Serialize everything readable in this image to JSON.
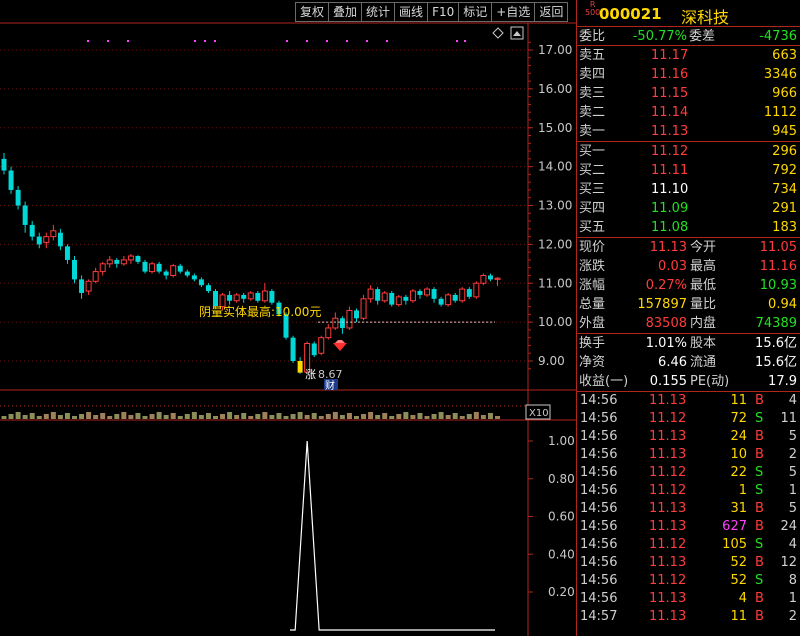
{
  "toolbar": [
    {
      "label": "复权"
    },
    {
      "label": "叠加"
    },
    {
      "label": "统计"
    },
    {
      "label": "画线"
    },
    {
      "label": "F10"
    },
    {
      "label": "标记"
    },
    {
      "label": "+自选"
    },
    {
      "label": "返回"
    }
  ],
  "chart_data": [
    {
      "type": "candlestick",
      "price_ticks": [
        "17.00",
        "16.00",
        "15.00",
        "14.00",
        "13.00",
        "12.00",
        "11.00",
        "10.00",
        "9.00"
      ],
      "ylim": [
        8.5,
        17.5
      ],
      "annotations": {
        "max_label": "阴量实体最高:10.00元",
        "max_value": 10.0,
        "min_label": "8.67",
        "min_value": 8.67,
        "cai_badge": "财",
        "up_label": "涨",
        "zoom_label": "X10"
      },
      "candles": [
        [
          14.2,
          13.9,
          14.35,
          13.8
        ],
        [
          13.9,
          13.4,
          14.0,
          13.3
        ],
        [
          13.4,
          13.0,
          13.5,
          12.9
        ],
        [
          13.0,
          12.5,
          13.1,
          12.3
        ],
        [
          12.5,
          12.2,
          12.6,
          12.1
        ],
        [
          12.2,
          12.0,
          12.3,
          11.9
        ],
        [
          12.05,
          12.2,
          12.3,
          11.9
        ],
        [
          12.2,
          12.35,
          12.5,
          12.1
        ],
        [
          12.3,
          11.95,
          12.4,
          11.85
        ],
        [
          11.95,
          11.6,
          12.0,
          11.5
        ],
        [
          11.6,
          11.1,
          11.7,
          11.0
        ],
        [
          11.1,
          10.75,
          11.2,
          10.6
        ],
        [
          10.8,
          11.05,
          11.1,
          10.7
        ],
        [
          11.05,
          11.3,
          11.4,
          11.0
        ],
        [
          11.3,
          11.5,
          11.55,
          11.2
        ],
        [
          11.5,
          11.6,
          11.7,
          11.4
        ],
        [
          11.6,
          11.5,
          11.65,
          11.4
        ],
        [
          11.5,
          11.6,
          11.7,
          11.45
        ],
        [
          11.6,
          11.7,
          11.75,
          11.5
        ],
        [
          11.7,
          11.55,
          11.72,
          11.5
        ],
        [
          11.55,
          11.3,
          11.6,
          11.25
        ],
        [
          11.3,
          11.5,
          11.55,
          11.25
        ],
        [
          11.5,
          11.3,
          11.55,
          11.25
        ],
        [
          11.3,
          11.2,
          11.35,
          11.1
        ],
        [
          11.2,
          11.45,
          11.5,
          11.15
        ],
        [
          11.45,
          11.3,
          11.5,
          11.25
        ],
        [
          11.3,
          11.2,
          11.35,
          11.15
        ],
        [
          11.2,
          11.1,
          11.25,
          11.05
        ],
        [
          11.1,
          10.95,
          11.15,
          10.9
        ],
        [
          10.95,
          10.8,
          11.0,
          10.75
        ],
        [
          10.8,
          10.4,
          10.85,
          10.35
        ],
        [
          10.4,
          10.7,
          10.75,
          10.3
        ],
        [
          10.7,
          10.55,
          10.8,
          10.45
        ],
        [
          10.55,
          10.7,
          10.75,
          10.5
        ],
        [
          10.7,
          10.6,
          10.75,
          10.5
        ],
        [
          10.6,
          10.75,
          10.8,
          10.55
        ],
        [
          10.75,
          10.55,
          10.8,
          10.5
        ],
        [
          10.55,
          10.8,
          11.0,
          10.5
        ],
        [
          10.8,
          10.5,
          10.85,
          10.45
        ],
        [
          10.5,
          10.2,
          10.55,
          10.15
        ],
        [
          10.2,
          9.6,
          10.25,
          9.55
        ],
        [
          9.6,
          9.0,
          9.65,
          8.95
        ],
        [
          9.0,
          8.7,
          9.1,
          8.67
        ],
        [
          8.72,
          9.45,
          9.5,
          8.68
        ],
        [
          9.45,
          9.15,
          9.5,
          9.1
        ],
        [
          9.2,
          9.6,
          9.65,
          9.15
        ],
        [
          9.6,
          9.85,
          9.95,
          9.55
        ],
        [
          9.85,
          10.1,
          10.25,
          9.8
        ],
        [
          10.1,
          9.85,
          10.15,
          9.7
        ],
        [
          9.85,
          10.3,
          10.4,
          9.8
        ],
        [
          10.3,
          10.1,
          10.35,
          10.0
        ],
        [
          10.1,
          10.6,
          10.7,
          10.05
        ],
        [
          10.6,
          10.85,
          10.95,
          10.5
        ],
        [
          10.85,
          10.55,
          10.9,
          10.45
        ],
        [
          10.55,
          10.75,
          10.8,
          10.5
        ],
        [
          10.75,
          10.45,
          10.8,
          10.4
        ],
        [
          10.45,
          10.65,
          10.7,
          10.4
        ],
        [
          10.65,
          10.55,
          10.7,
          10.45
        ],
        [
          10.55,
          10.8,
          10.85,
          10.5
        ],
        [
          10.8,
          10.7,
          10.85,
          10.6
        ],
        [
          10.7,
          10.85,
          10.9,
          10.65
        ],
        [
          10.85,
          10.6,
          10.9,
          10.5
        ],
        [
          10.6,
          10.45,
          10.65,
          10.4
        ],
        [
          10.45,
          10.7,
          10.75,
          10.4
        ],
        [
          10.7,
          10.55,
          10.75,
          10.5
        ],
        [
          10.55,
          10.85,
          10.9,
          10.5
        ],
        [
          10.85,
          10.65,
          10.9,
          10.6
        ],
        [
          10.65,
          11.0,
          11.05,
          10.6
        ],
        [
          11.0,
          11.2,
          11.25,
          10.95
        ],
        [
          11.2,
          11.1,
          11.25,
          11.05
        ],
        [
          11.1,
          11.13,
          11.16,
          10.93
        ]
      ]
    },
    {
      "type": "line",
      "yticks": [
        "1.00",
        "0.80",
        "0.60",
        "0.40",
        "0.20"
      ],
      "ylim": [
        0,
        1.1
      ],
      "peak_index": 43,
      "peak_value": 1.0
    }
  ],
  "panel": {
    "rtag_top": "R",
    "rtag_bottom": "500",
    "code": "000021",
    "name": "深科技",
    "ratio": {
      "l1": "委比",
      "v1": "-50.77%",
      "l2": "委差",
      "v2": "-4736"
    },
    "asks": [
      {
        "label": "卖五",
        "price": "11.17",
        "vol": "663"
      },
      {
        "label": "卖四",
        "price": "11.16",
        "vol": "3346"
      },
      {
        "label": "卖三",
        "price": "11.15",
        "vol": "966"
      },
      {
        "label": "卖二",
        "price": "11.14",
        "vol": "1112"
      },
      {
        "label": "卖一",
        "price": "11.13",
        "vol": "945"
      }
    ],
    "bids": [
      {
        "label": "买一",
        "price": "11.12",
        "vol": "296"
      },
      {
        "label": "买二",
        "price": "11.11",
        "vol": "792"
      },
      {
        "label": "买三",
        "price": "11.10",
        "vol": "734"
      },
      {
        "label": "买四",
        "price": "11.09",
        "vol": "291"
      },
      {
        "label": "买五",
        "price": "11.08",
        "vol": "183"
      }
    ],
    "quote1": [
      {
        "l1": "现价",
        "v1": "11.13",
        "l2": "今开",
        "v2": "11.05"
      },
      {
        "l1": "涨跌",
        "v1": "0.03",
        "l2": "最高",
        "v2": "11.16"
      },
      {
        "l1": "涨幅",
        "v1": "0.27%",
        "l2": "最低",
        "v2": "10.93"
      },
      {
        "l1": "总量",
        "v1": "157897",
        "l2": "量比",
        "v2": "0.94"
      },
      {
        "l1": "外盘",
        "v1": "83508",
        "l2": "内盘",
        "v2": "74389"
      }
    ],
    "quote2": [
      {
        "l1": "换手",
        "v1": "1.01%",
        "l2": "股本",
        "v2": "15.6亿"
      },
      {
        "l1": "净资",
        "v1": "6.46",
        "l2": "流通",
        "v2": "15.6亿"
      },
      {
        "l1": "收益(一)",
        "v1": "0.155",
        "l2": "PE(动)",
        "v2": "17.9"
      }
    ],
    "trades": [
      {
        "time": "14:56",
        "price": "11.13",
        "vol": "11",
        "side": "B",
        "count": "4"
      },
      {
        "time": "14:56",
        "price": "11.12",
        "vol": "72",
        "side": "S",
        "count": "11"
      },
      {
        "time": "14:56",
        "price": "11.13",
        "vol": "24",
        "side": "B",
        "count": "5"
      },
      {
        "time": "14:56",
        "price": "11.13",
        "vol": "10",
        "side": "B",
        "count": "2"
      },
      {
        "time": "14:56",
        "price": "11.12",
        "vol": "22",
        "side": "S",
        "count": "5"
      },
      {
        "time": "14:56",
        "price": "11.12",
        "vol": "1",
        "side": "S",
        "count": "1"
      },
      {
        "time": "14:56",
        "price": "11.13",
        "vol": "31",
        "side": "B",
        "count": "5"
      },
      {
        "time": "14:56",
        "price": "11.13",
        "vol": "627",
        "side": "B",
        "count": "24"
      },
      {
        "time": "14:56",
        "price": "11.12",
        "vol": "105",
        "side": "S",
        "count": "4"
      },
      {
        "time": "14:56",
        "price": "11.13",
        "vol": "52",
        "side": "B",
        "count": "12"
      },
      {
        "time": "14:56",
        "price": "11.12",
        "vol": "52",
        "side": "S",
        "count": "8"
      },
      {
        "time": "14:56",
        "price": "11.13",
        "vol": "4",
        "side": "B",
        "count": "1"
      },
      {
        "time": "14:57",
        "price": "11.13",
        "vol": "11",
        "side": "B",
        "count": "2"
      }
    ],
    "colors": {
      "up": "#ff3c3c",
      "down": "#22e022",
      "even": "#ffffff",
      "accent": "#ffd800",
      "border": "#b0261f",
      "big": "#ff40ff"
    }
  }
}
